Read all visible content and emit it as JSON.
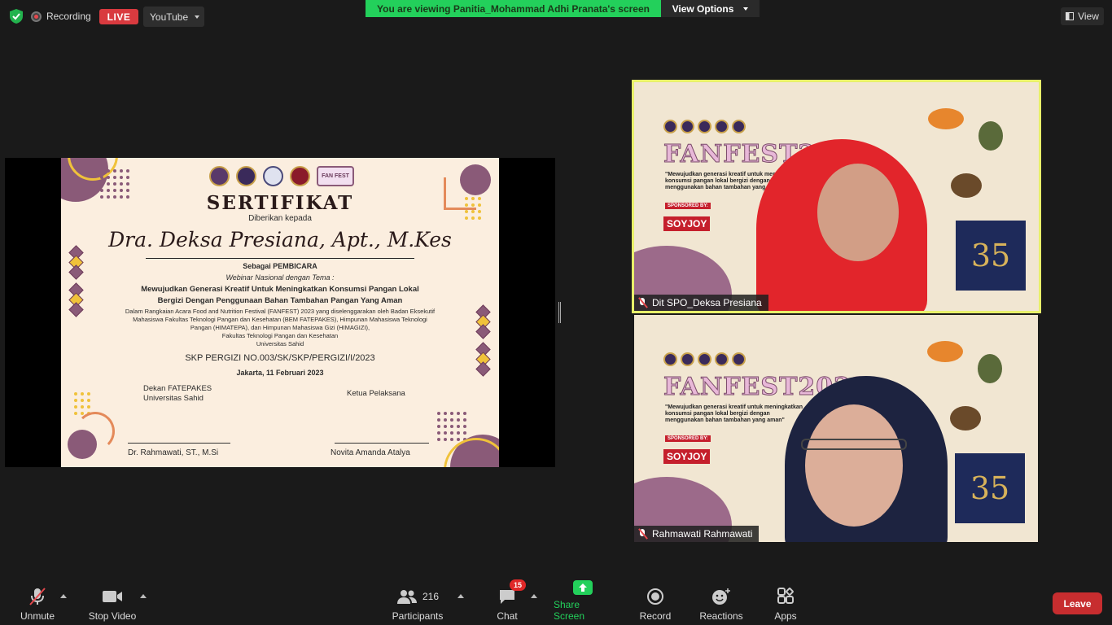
{
  "topbar": {
    "recording_label": "Recording",
    "live_label": "LIVE",
    "youtube_label": "YouTube",
    "banner_text": "You are viewing Panitia_Mohammad Adhi Pranata's screen",
    "view_options_label": "View Options",
    "view_label": "View"
  },
  "certificate": {
    "title": "SERTIFIKAT",
    "given_to": "Diberikan kepada",
    "name": "Dra. Deksa Presiana, Apt., M.Kes",
    "role": "Sebagai PEMBICARA",
    "webinar": "Webinar Nasional dengan Tema :",
    "theme_line1": "Mewujudkan Generasi Kreatif Untuk Meningkatkan Konsumsi Pangan Lokal",
    "theme_line2": "Bergizi Dengan Penggunaan Bahan Tambahan Pangan Yang Aman",
    "desc_line1": "Dalam Rangkaian Acara Food and Nutrition Festival (FANFEST) 2023 yang diselenggarakan oleh Badan Eksekutif",
    "desc_line2": "Mahasiswa Fakultas Teknologi Pangan dan Kesehatan (BEM FATEPAKES), Himpunan Mahasiswa Teknologi",
    "desc_line3": "Pangan (HIMATEPA), dan Himpunan Mahasiswa Gizi (HIMAGIZI),",
    "desc_line4": "Fakultas Teknologi Pangan dan Kesehatan",
    "desc_line5": "Universitas Sahid",
    "skp": "SKP PERGIZI NO.003/SK/SKP/PERGIZI/I/2023",
    "date": "Jakarta, 11 Februari 2023",
    "left_title_1": "Dekan FATEPAKES",
    "left_title_2": "Universitas Sahid",
    "right_title": "Ketua Pelaksana",
    "left_signer": "Dr. Rahmawati, ST., M.Si",
    "right_signer": "Novita Amanda Atalya",
    "logo_fam_text": "FAN FEST"
  },
  "tiles": [
    {
      "name": "Dit SPO_Deksa Presiana",
      "fanfest": "FANFEST2023",
      "quote": "\"Mewujudkan generasi kreatif untuk meningkatkan konsumsi pangan lokal bergizi dengan menggunakan bahan tambahan yang aman\"",
      "sponsored": "SPONSORED BY:",
      "sponsor": "SOYJOY",
      "dies": "35",
      "active_speaker": true
    },
    {
      "name": "Rahmawati Rahmawati",
      "fanfest": "FANFEST2023",
      "quote": "\"Mewujudkan generasi kreatif untuk meningkatkan konsumsi pangan lokal bergizi dengan menggunakan bahan tambahan yang aman\"",
      "sponsored": "SPONSORED BY:",
      "sponsor": "SOYJOY",
      "dies": "35",
      "active_speaker": false
    }
  ],
  "toolbar": {
    "unmute": "Unmute",
    "stop_video": "Stop Video",
    "participants": "Participants",
    "participants_count": "216",
    "chat": "Chat",
    "chat_badge": "15",
    "share_screen": "Share Screen",
    "record": "Record",
    "reactions": "Reactions",
    "apps": "Apps",
    "leave": "Leave"
  },
  "colors": {
    "accent_green": "#23d05b",
    "live_red": "#d93a3f",
    "leave_red": "#c72d2f",
    "active_speaker_border": "#e8f06a",
    "certificate_bg": "#fbeedf",
    "certificate_purple": "#8a5a78"
  }
}
